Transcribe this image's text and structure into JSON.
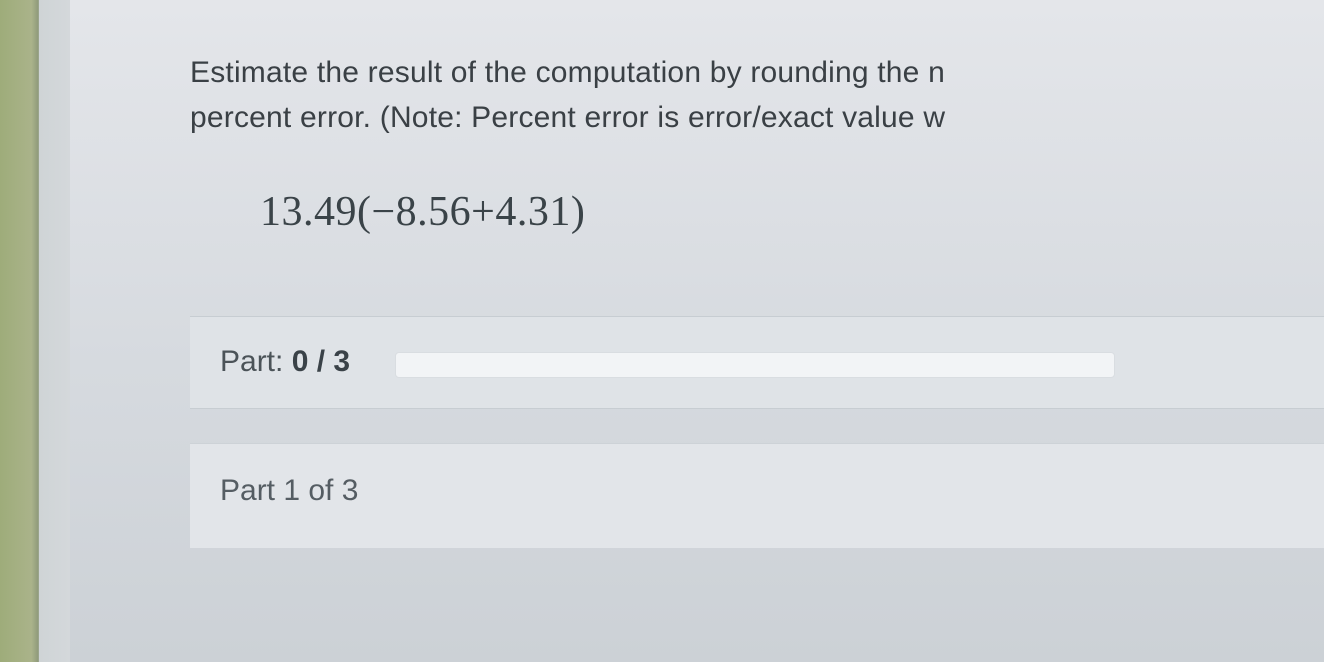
{
  "question": {
    "line1": "Estimate the result of the computation by rounding the n",
    "line2": "percent error. (Note: Percent error is error/exact value w"
  },
  "expression": "13.49(−8.56+4.31)",
  "progress": {
    "prefix": "Part: ",
    "current": "0",
    "sep": " / ",
    "total": "3"
  },
  "part_header": "Part 1 of 3"
}
